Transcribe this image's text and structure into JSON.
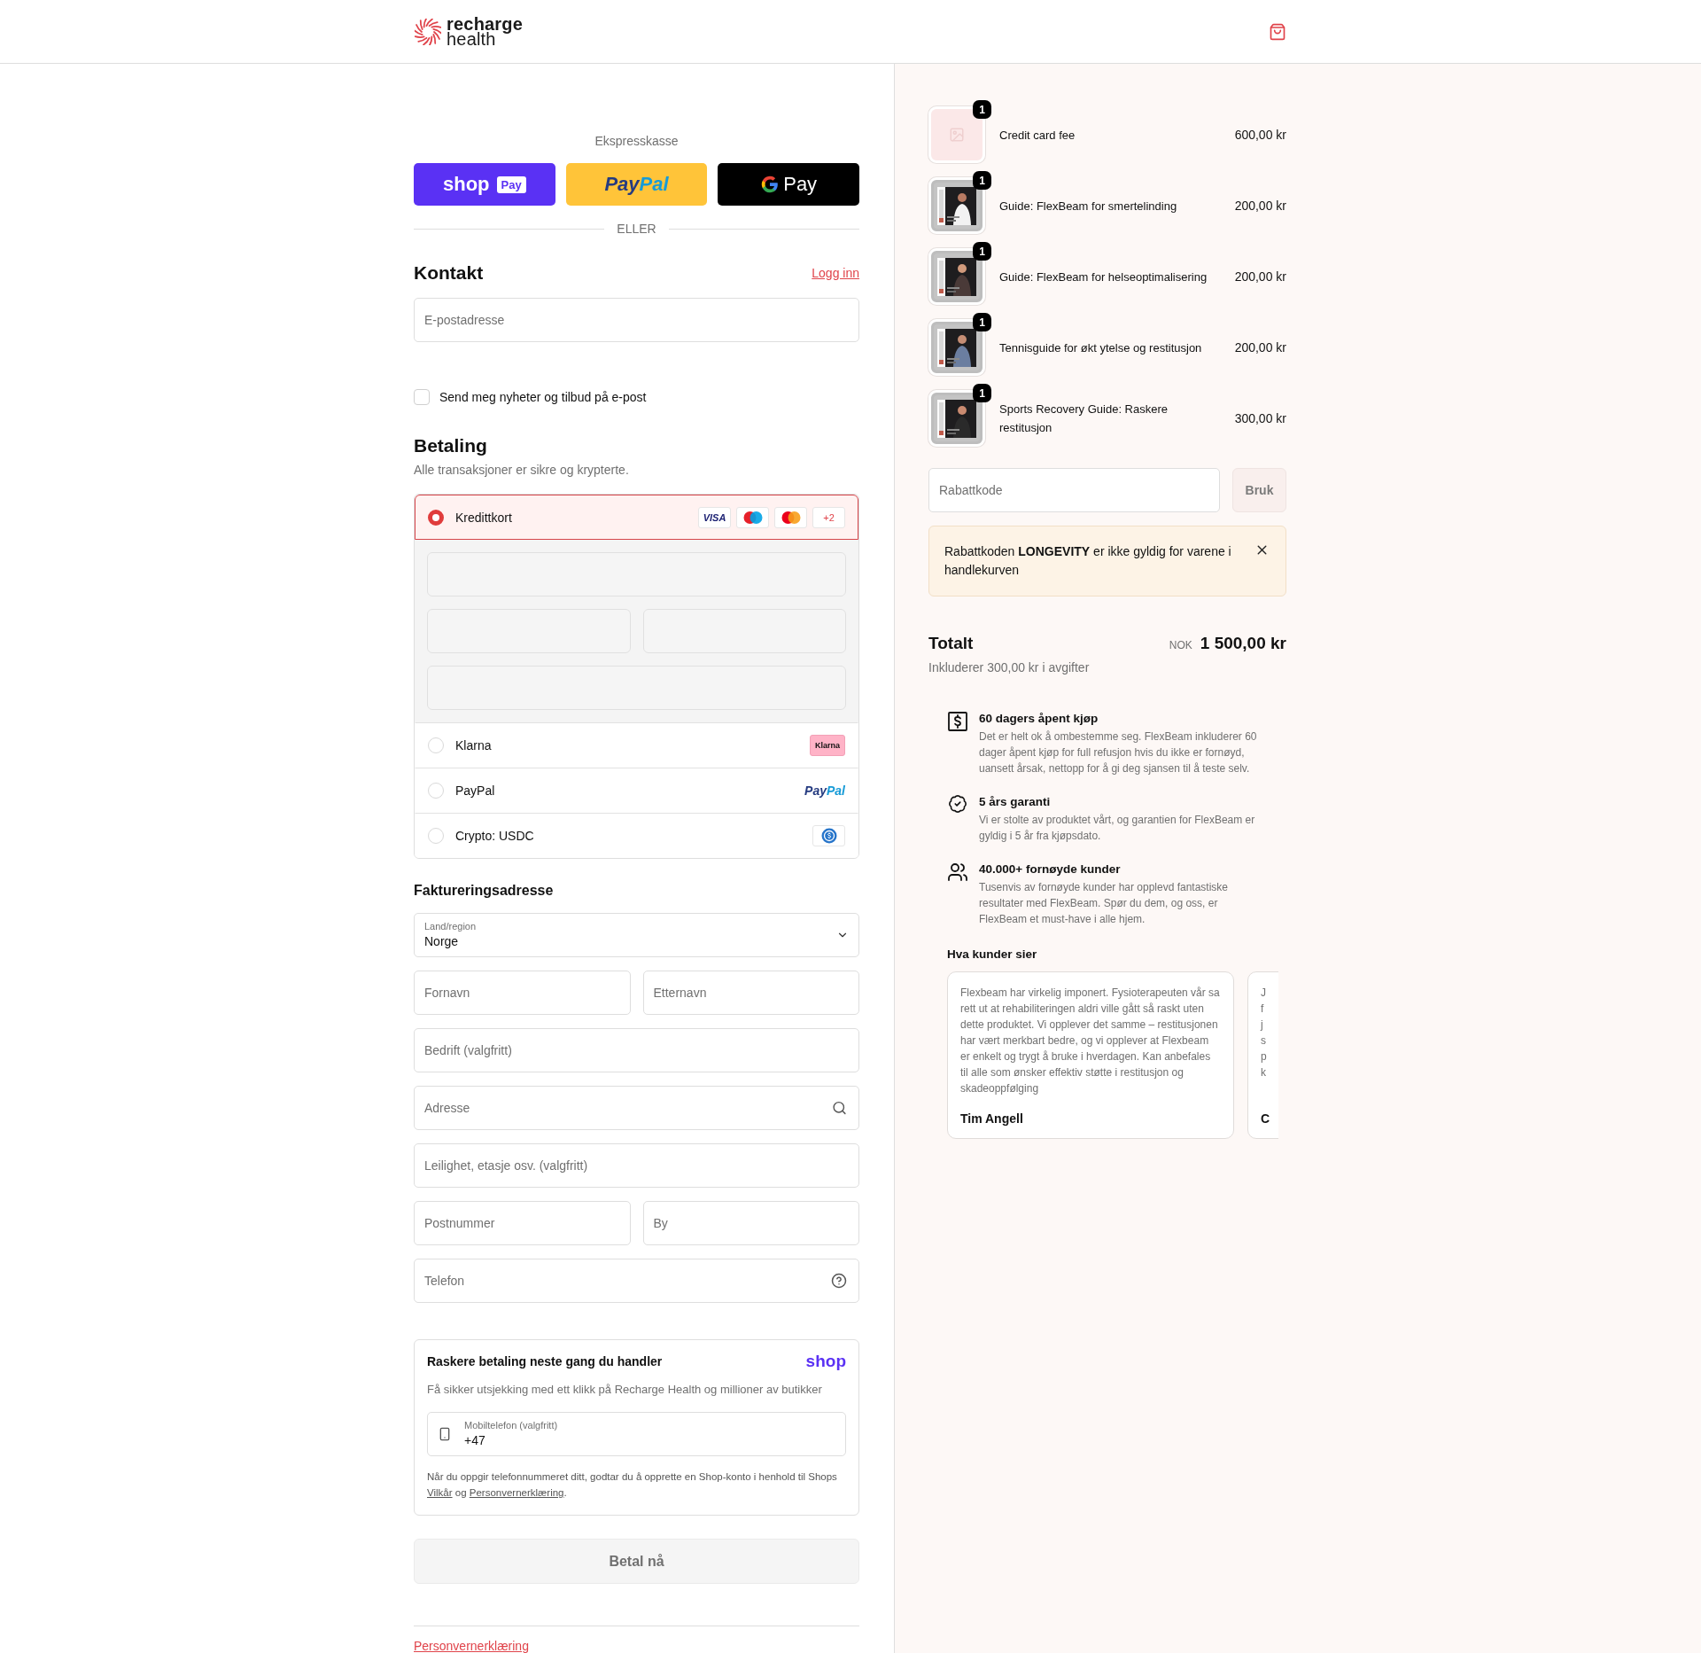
{
  "header": {
    "logo": {
      "line_1": "recharge",
      "line_2": "health"
    }
  },
  "express_checkout": {
    "title": "Ekspresskasse",
    "buttons": [
      {
        "kind": "shop_pay",
        "label": "shop",
        "badge": "Pay"
      },
      {
        "kind": "paypal",
        "label_1": "Pay",
        "label_2": "Pal"
      },
      {
        "kind": "google_pay",
        "label": "Pay"
      }
    ],
    "divider": "ELLER"
  },
  "contact": {
    "title": "Kontakt",
    "login_link": "Logg inn",
    "email": {
      "placeholder": "E-postadresse"
    },
    "newsletter": {
      "label": "Send meg nyheter og tilbud på e-post",
      "checked": false
    }
  },
  "payment": {
    "title": "Betaling",
    "subtitle": "Alle transaksjoner er sikre og krypterte.",
    "methods": [
      {
        "kind": "card",
        "label": "Kredittkort",
        "selected": true,
        "brands": [
          {
            "kind": "visa",
            "text": "VISA"
          },
          {
            "kind": "maestro"
          },
          {
            "kind": "mastercard"
          }
        ],
        "more": "+2",
        "card_fields": [
          {
            "kind": "full"
          },
          {
            "kind": "half"
          },
          {
            "kind": "half"
          },
          {
            "kind": "full"
          }
        ]
      },
      {
        "kind": "klarna",
        "label": "Klarna",
        "badge": "Klarna",
        "selected": false
      },
      {
        "kind": "paypal",
        "label": "PayPal",
        "logo_1": "Pay",
        "logo_2": "Pal",
        "selected": false
      },
      {
        "kind": "crypto",
        "label": "Crypto: USDC",
        "selected": false
      }
    ]
  },
  "billing": {
    "title": "Faktureringsadresse",
    "country": {
      "label": "Land/region",
      "value": "Norge"
    },
    "rows": [
      {
        "fields": [
          {
            "placeholder": "Fornavn",
            "kind": "plain"
          },
          {
            "placeholder": "Etternavn",
            "kind": "plain"
          }
        ]
      },
      {
        "fields": [
          {
            "placeholder": "Bedrift (valgfritt)",
            "kind": "plain"
          }
        ]
      },
      {
        "fields": [
          {
            "placeholder": "Adresse",
            "kind": "search"
          }
        ]
      },
      {
        "fields": [
          {
            "placeholder": "Leilighet, etasje osv. (valgfritt)",
            "kind": "plain"
          }
        ]
      },
      {
        "fields": [
          {
            "placeholder": "Postnummer",
            "kind": "plain"
          },
          {
            "placeholder": "By",
            "kind": "plain"
          }
        ]
      },
      {
        "fields": [
          {
            "placeholder": "Telefon",
            "kind": "help"
          }
        ]
      }
    ]
  },
  "shop_pay": {
    "title": "Raskere betaling neste gang du handler",
    "logo": "shop",
    "description": "Få sikker utsjekking med ett klikk på Recharge Health og millioner av butikker",
    "phone": {
      "label": "Mobiltelefon (valgfritt)",
      "value": "+47"
    },
    "legal": {
      "text": "Når du oppgir telefonnummeret ditt, godtar du å opprette en Shop-konto i henhold til Shops",
      "link_1": "Vilkår",
      "joiner": "og",
      "link_2": "Personvernerklæring",
      "end": "."
    }
  },
  "pay_button": {
    "label": "Betal nå",
    "disabled": true
  },
  "footer": {
    "links": [
      "Personvernerklæring"
    ]
  },
  "order_summary": {
    "items": [
      {
        "kind": "placeholder",
        "name": "Credit card fee",
        "price": "600,00 kr",
        "quantity": "1"
      },
      {
        "kind": "picture",
        "name": "Guide: FlexBeam for smertelinding",
        "price": "200,00 kr",
        "quantity": "1"
      },
      {
        "kind": "picture",
        "name": "Guide: FlexBeam for helseoptimalisering",
        "price": "200,00 kr",
        "quantity": "1"
      },
      {
        "kind": "picture",
        "name": "Tennisguide for økt ytelse og restitusjon",
        "price": "200,00 kr",
        "quantity": "1"
      },
      {
        "kind": "picture",
        "name": "Sports Recovery Guide: Raskere restitusjon",
        "price": "300,00 kr",
        "quantity": "1"
      }
    ],
    "discount": {
      "placeholder": "Rabattkode",
      "button": "Bruk"
    },
    "alert": {
      "text": "Rabattkoden **LONGEVITY** er ikke gyldig for varene i handlekurven"
    },
    "total": {
      "label": "Totalt",
      "currency": "NOK",
      "amount": "1 500,00 kr",
      "note": "Inkluderer 300,00 kr i avgifter"
    },
    "features": [
      {
        "kind": "dollar",
        "title": "60 dagers åpent kjøp",
        "text": "Det er helt ok å ombestemme seg. FlexBeam inkluderer 60 dager åpent kjøp for full refusjon hvis du ikke er fornøyd, uansett årsak, nettopp for å gi deg sjansen til å teste selv."
      },
      {
        "kind": "badge",
        "title": "5 års garanti",
        "text": "Vi er stolte av produktet vårt, og garantien for FlexBeam er gyldig i 5 år fra kjøpsdato."
      },
      {
        "kind": "people",
        "title": "40.000+ fornøyde kunder",
        "text": "Tusenvis av fornøyde kunder har opplevd fantastiske resultater med FlexBeam. Spør du dem, og oss, er FlexBeam et must-have i alle hjem."
      }
    ],
    "reviews": {
      "title": "Hva kunder sier",
      "cards": [
        {
          "text": "Flexbeam har virkelig imponert. Fysioterapeuten vår sa rett ut at rehabiliteringen aldri ville gått så raskt uten dette produktet. Vi opplever det samme – restitusjonen har vært merkbart bedre, og vi opplever at Flexbeam er enkelt og trygt å bruke i hverdagen. Kan anbefales til alle som ønsker effektiv støtte i restitusjon og skadeoppfølging",
          "author": "Tim Angell"
        },
        {
          "lines": [
            "J",
            "f",
            "j",
            "s",
            "p",
            "k"
          ],
          "author": "C"
        }
      ]
    }
  }
}
